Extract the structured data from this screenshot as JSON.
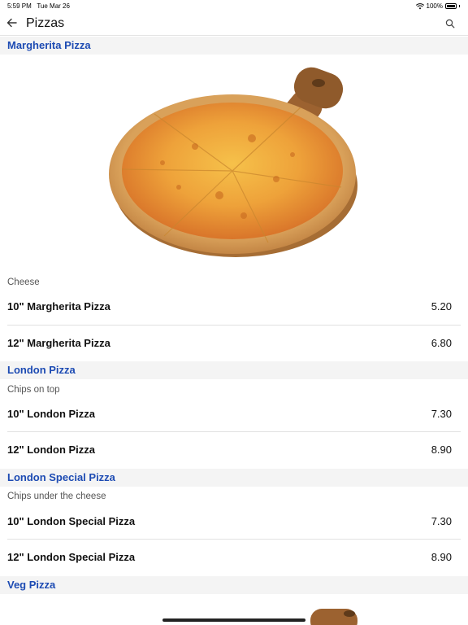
{
  "status_bar": {
    "time": "5:59 PM",
    "date": "Tue Mar 26",
    "battery": "100%"
  },
  "nav": {
    "title": "Pizzas",
    "back_icon": "arrow-left-icon",
    "search_icon": "search-icon"
  },
  "sections": [
    {
      "title": "Margherita Pizza",
      "description": "Cheese",
      "items": [
        {
          "name": "10\" Margherita Pizza",
          "price": "5.20"
        },
        {
          "name": "12\" Margherita Pizza",
          "price": "6.80"
        }
      ]
    },
    {
      "title": "London Pizza",
      "description": "Chips on top",
      "items": [
        {
          "name": "10\" London Pizza",
          "price": "7.30"
        },
        {
          "name": "12\" London Pizza",
          "price": "8.90"
        }
      ]
    },
    {
      "title": "London Special Pizza",
      "description": "Chips under the cheese",
      "items": [
        {
          "name": "10\" London Special Pizza",
          "price": "7.30"
        },
        {
          "name": "12\" London Special Pizza",
          "price": "8.90"
        }
      ]
    },
    {
      "title": "Veg Pizza"
    }
  ],
  "colors": {
    "section_title": "#1d4bb3",
    "section_band": "#f4f4f4"
  }
}
